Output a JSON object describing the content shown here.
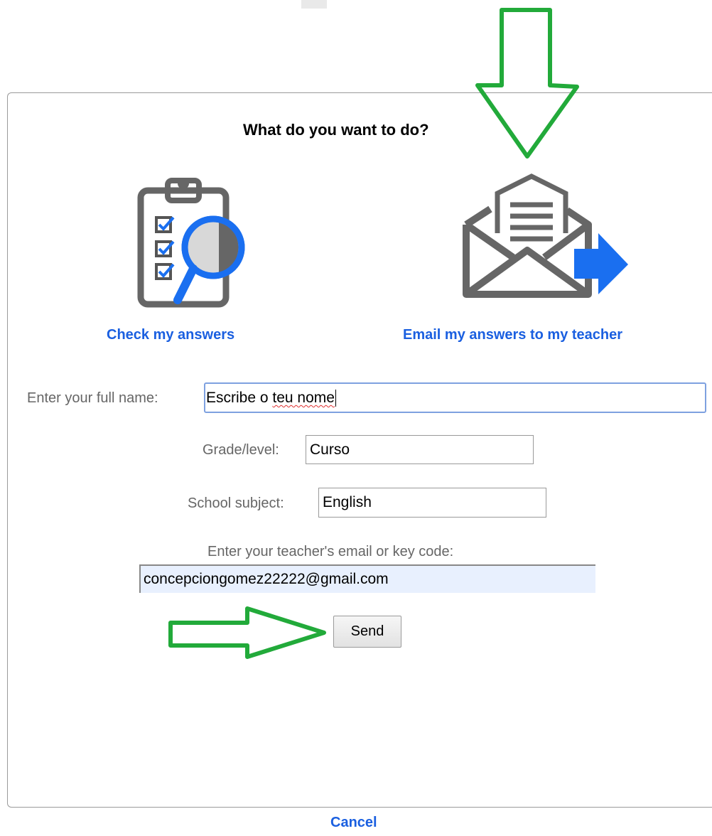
{
  "dialog": {
    "title": "What do you want to do?",
    "options": [
      {
        "label": "Check my answers",
        "icon": "clipboard-search-icon"
      },
      {
        "label": "Email my answers to my teacher",
        "icon": "envelope-send-icon"
      }
    ]
  },
  "form": {
    "name_label": "Enter your full name:",
    "name_value_plain": "Escribe o ",
    "name_value_misspelled": "teu nome",
    "grade_label": "Grade/level:",
    "grade_value": "Curso",
    "subject_label": "School subject:",
    "subject_value": "English",
    "teacher_label": "Enter your teacher's email or key code:",
    "teacher_value": "concepciongomez22222@gmail.com"
  },
  "buttons": {
    "send": "Send",
    "cancel": "Cancel"
  },
  "colors": {
    "link": "#1a5fe0",
    "annotation_arrow": "#22aa3a",
    "icon_gray": "#666666",
    "icon_blue": "#1a6ff0"
  }
}
